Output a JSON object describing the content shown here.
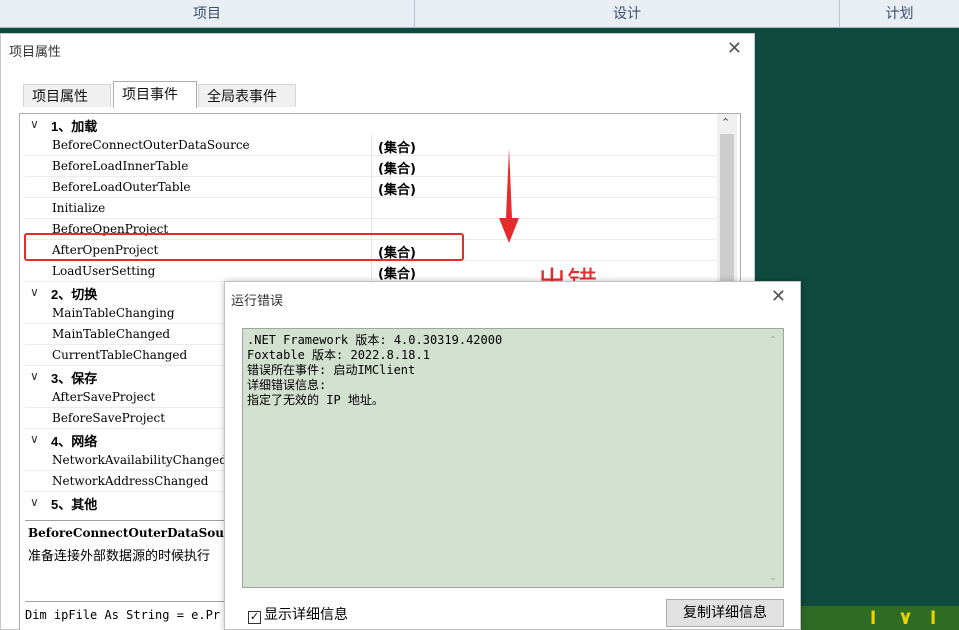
{
  "top_tabs": [
    "项目",
    "设计",
    "计划"
  ],
  "window": {
    "title": "项目属性",
    "tabs": [
      "项目属性",
      "项目事件",
      "全局表事件"
    ],
    "active_tab": "项目事件",
    "categories": [
      {
        "label": "1、加载",
        "items": [
          {
            "name": "BeforeConnectOuterDataSource",
            "value": "(集合)"
          },
          {
            "name": "BeforeLoadInnerTable",
            "value": "(集合)"
          },
          {
            "name": "BeforeLoadOuterTable",
            "value": "(集合)"
          },
          {
            "name": "Initialize",
            "value": ""
          },
          {
            "name": "BeforeOpenProject",
            "value": ""
          },
          {
            "name": "AfterOpenProject",
            "value": "(集合)"
          },
          {
            "name": "LoadUserSetting",
            "value": "(集合)"
          }
        ]
      },
      {
        "label": "2、切换",
        "items": [
          {
            "name": "MainTableChanging",
            "value": ""
          },
          {
            "name": "MainTableChanged",
            "value": ""
          },
          {
            "name": "CurrentTableChanged",
            "value": ""
          }
        ]
      },
      {
        "label": "3、保存",
        "items": [
          {
            "name": "AfterSaveProject",
            "value": ""
          },
          {
            "name": "BeforeSaveProject",
            "value": ""
          }
        ]
      },
      {
        "label": "4、网络",
        "items": [
          {
            "name": "NetworkAvailabilityChanged",
            "value": ""
          },
          {
            "name": "NetworkAddressChanged",
            "value": ""
          }
        ]
      },
      {
        "label": "5、其他",
        "items": []
      }
    ],
    "description_name": "BeforeConnectOuterDataSource",
    "description_text": "准备连接外部数据源的时候执行",
    "code_line": "Dim ipFile As String = e.Pr"
  },
  "annotation": "出错",
  "error_dialog": {
    "title": "运行错误",
    "lines": [
      ".NET Framework 版本: 4.0.30319.42000",
      "Foxtable 版本: 2022.8.18.1",
      "错误所在事件: 启动IMClient",
      "详细错误信息:",
      "指定了无效的 IP 地址。"
    ],
    "show_details_label": "显示详细信息",
    "show_details_checked": true,
    "copy_button_label": "复制详细信息"
  },
  "colors": {
    "highlight": "#e52b2b",
    "board": "#0f4a3f",
    "error_bg": "#d2e0cf"
  }
}
